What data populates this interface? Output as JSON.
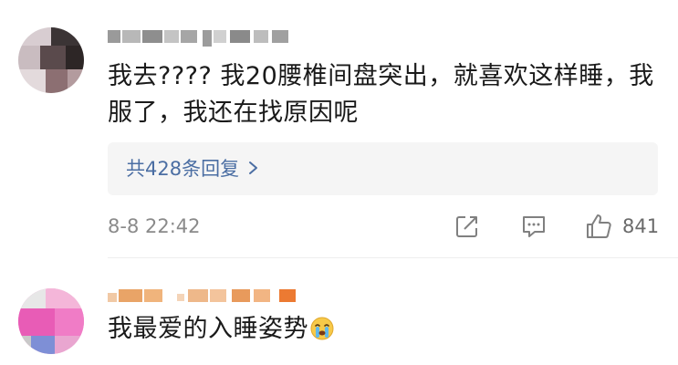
{
  "comments": [
    {
      "text": "我去???? 我20腰椎间盘突出，就喜欢这样睡，我\n服了，我还在找原因呢",
      "replies_label": "共428条回复",
      "time": "8-8 22:42",
      "like_count": "841"
    },
    {
      "text": "我最爱的入睡姿势"
    }
  ],
  "icons": {
    "share": "share-icon",
    "comment": "comment-icon",
    "like": "thumbs-up-icon",
    "chevron": "chevron-right-icon",
    "emoji": "crying-face-emoji"
  },
  "colors": {
    "link": "#4b6ea3",
    "meta": "#8a8a8a",
    "reply_bg": "#f5f5f5"
  }
}
